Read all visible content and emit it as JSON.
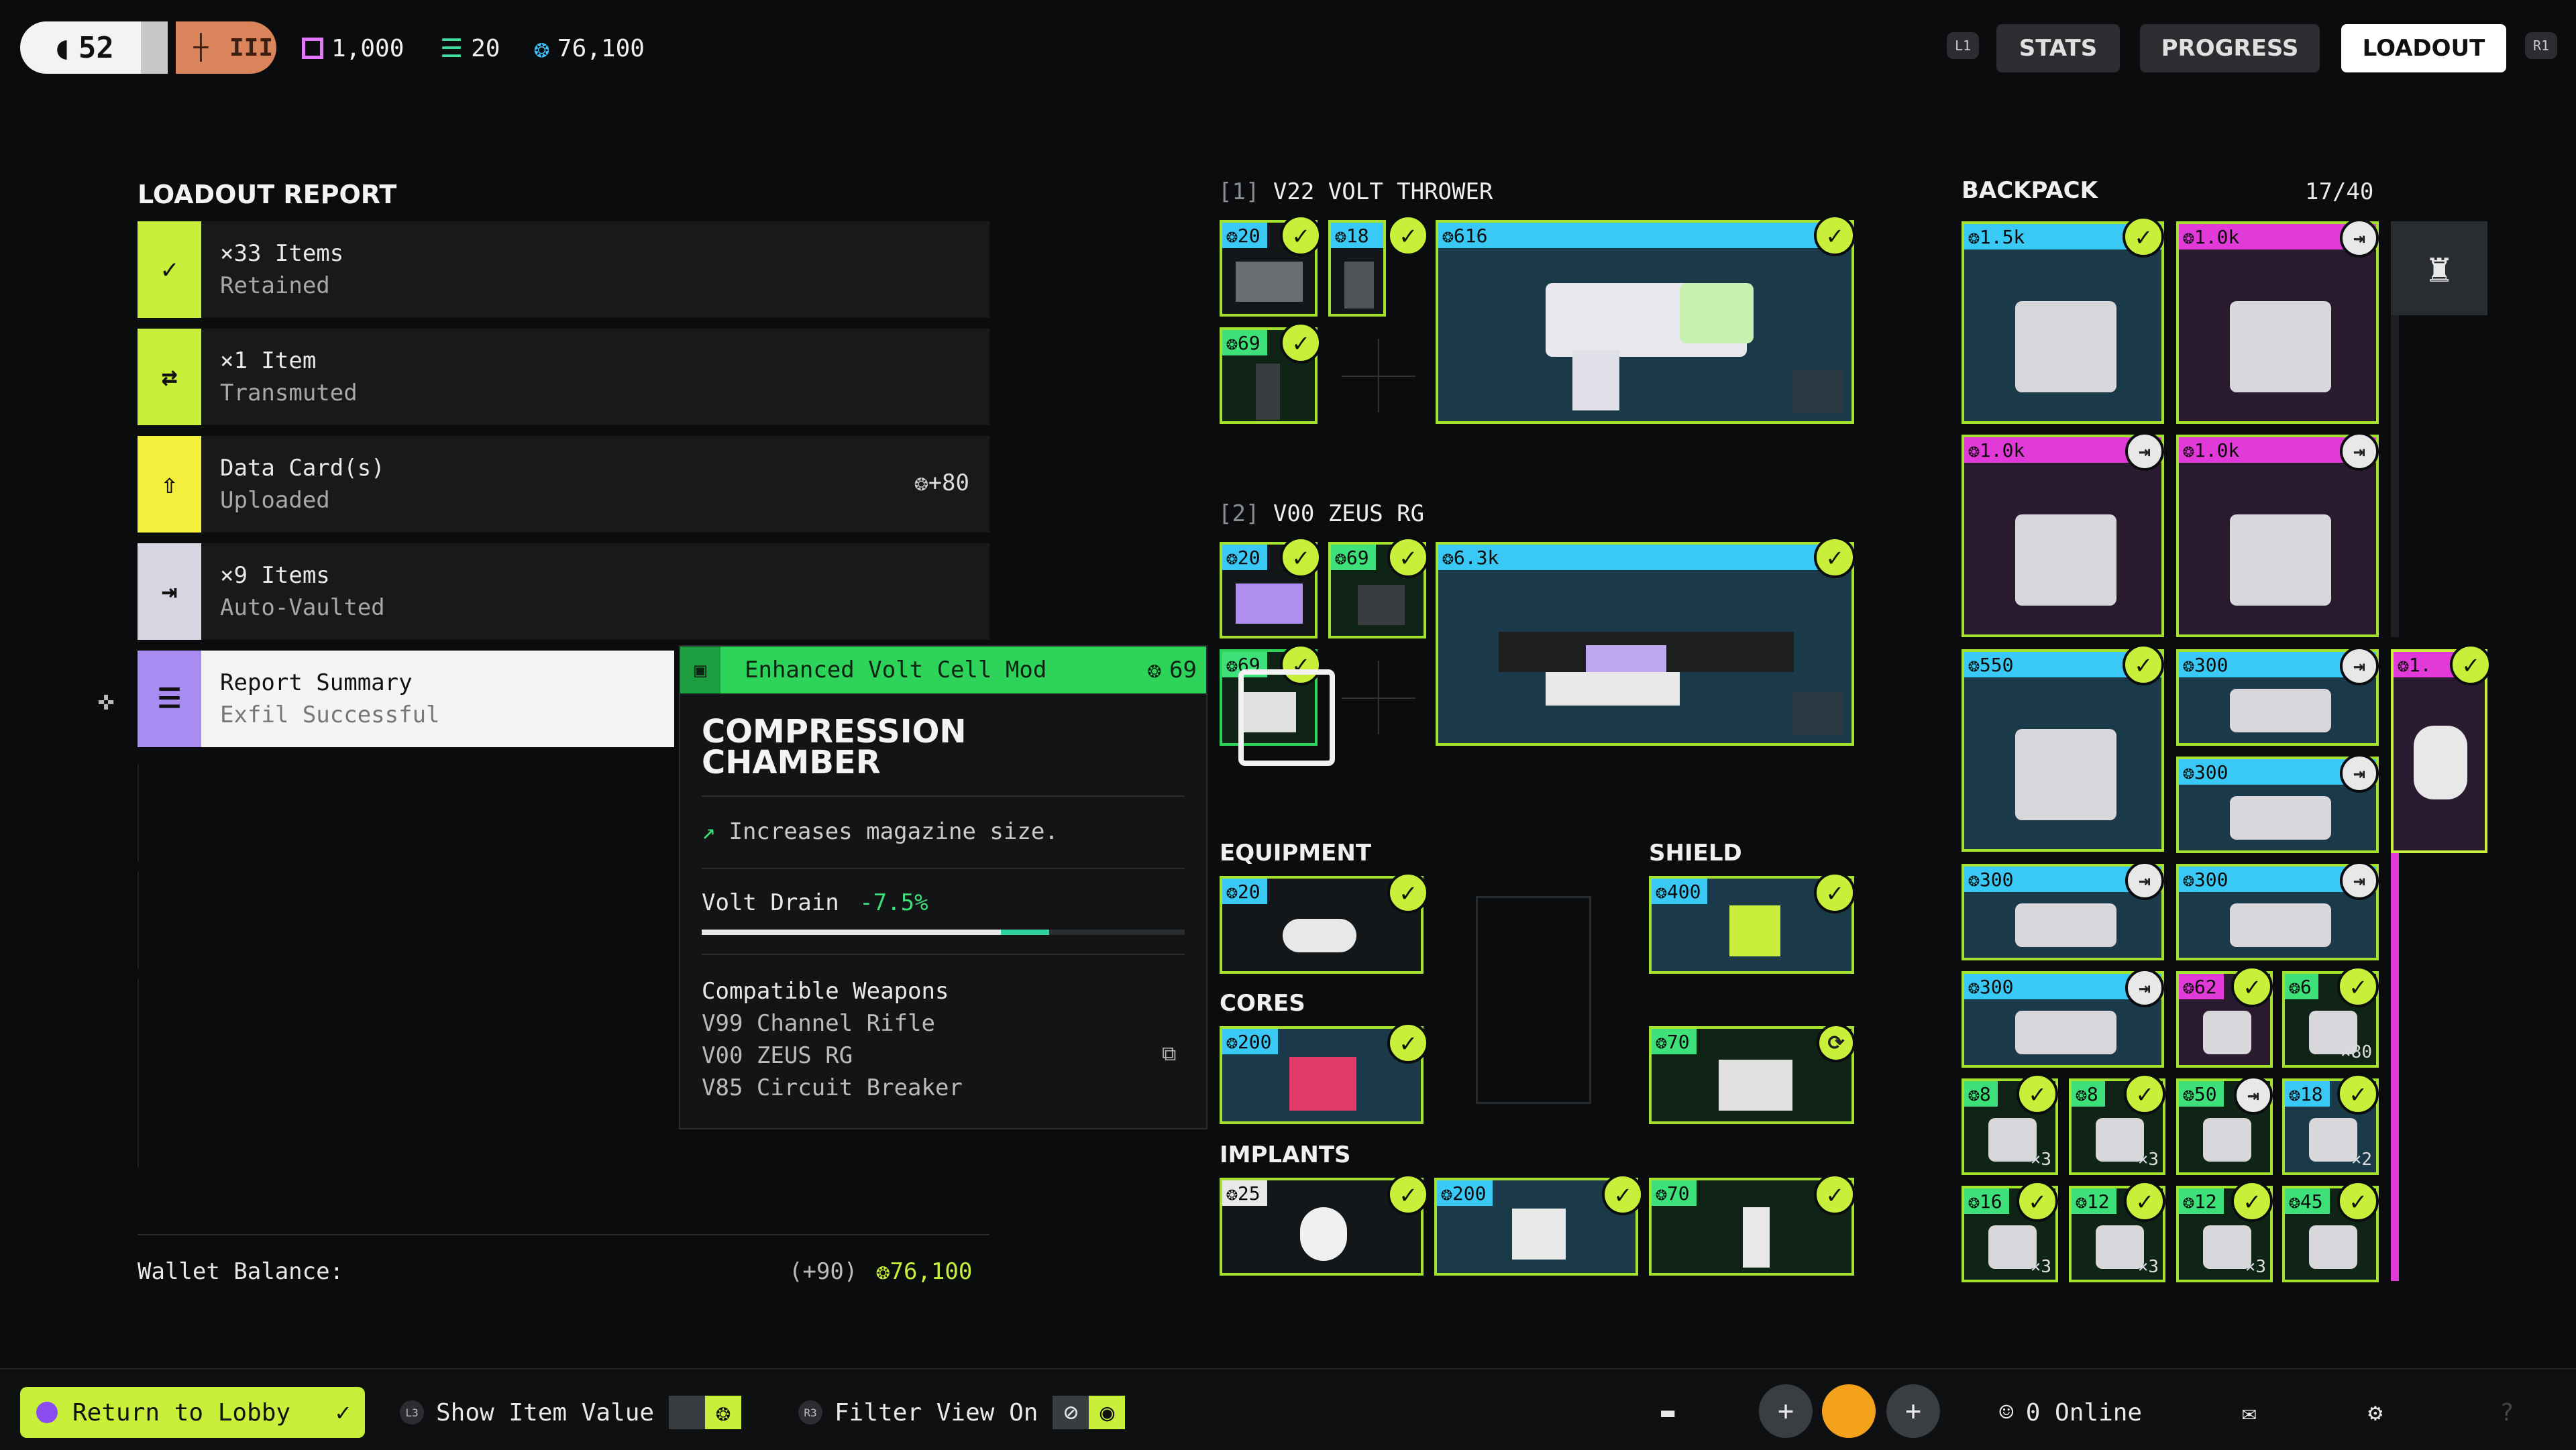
{
  "topbar": {
    "level": "52",
    "rank_numeral": "III",
    "currencies": [
      {
        "icon": "chip-icon",
        "value": "1,000",
        "color": "#e278ff"
      },
      {
        "icon": "stack-icon",
        "value": "20",
        "color": "#3ee0a0"
      },
      {
        "icon": "credits-icon",
        "value": "76,100",
        "color": "#3fc3ff"
      }
    ],
    "left_shoulder": "L1",
    "right_shoulder": "R1",
    "tabs": [
      "STATS",
      "PROGRESS",
      "LOADOUT"
    ],
    "active_tab": "LOADOUT"
  },
  "report": {
    "title": "LOADOUT REPORT",
    "rows": [
      {
        "line1": "×33 Items",
        "line2": "Retained",
        "icon": "check-icon",
        "color": "#c8f03a",
        "extra": ""
      },
      {
        "line1": "×1 Item",
        "line2": "Transmuted",
        "icon": "transmute-icon",
        "color": "#c8f03a",
        "extra": ""
      },
      {
        "line1": "Data Card(s)",
        "line2": "Uploaded",
        "icon": "upload-icon",
        "color": "#f4ef3d",
        "extra": "+80"
      },
      {
        "line1": "×9 Items",
        "line2": "Auto-Vaulted",
        "icon": "vault-icon",
        "color": "#d6d6e2",
        "extra": ""
      },
      {
        "line1": "Report Summary",
        "line2": "Exfil Successful",
        "icon": "list-icon",
        "color": "#a98cf2",
        "extra": ""
      }
    ],
    "wallet_label": "Wallet Balance:",
    "wallet_delta": "(+90)",
    "wallet_value": "76,100"
  },
  "tooltip": {
    "header": "Enhanced Volt Cell Mod",
    "header_value": "69",
    "title_line1": "COMPRESSION",
    "title_line2": "CHAMBER",
    "description": "Increases magazine size.",
    "stat_label": "Volt Drain",
    "stat_value": "-7.5%",
    "stat_fill": 0.72,
    "compatible_label": "Compatible Weapons",
    "weapons": [
      "V99 Channel Rifle",
      "V00 ZEUS RG",
      "V85 Circuit Breaker"
    ]
  },
  "weapons": [
    {
      "slot": "[1]",
      "name": "V22 VOLT THROWER",
      "main_value": "616",
      "mods": [
        "20",
        "18",
        "69"
      ]
    },
    {
      "slot": "[2]",
      "name": "V00 ZEUS RG",
      "main_value": "6.3k",
      "mods": [
        "20",
        "69",
        "69"
      ]
    }
  ],
  "gear": {
    "equipment_label": "EQUIPMENT",
    "equipment_value": "20",
    "shield_label": "SHIELD",
    "shield_value": "400",
    "cores_label": "CORES",
    "cores_values": [
      "200",
      "70"
    ],
    "implants_label": "IMPLANTS",
    "implants_values": [
      "25",
      "200",
      "70"
    ]
  },
  "backpack": {
    "title": "BACKPACK",
    "capacity": "17/40",
    "items": [
      {
        "value": "1.5k",
        "color": "#3ac8f5"
      },
      {
        "value": "1.0k",
        "color": "#e23ad8"
      },
      {
        "value": "1.0k",
        "color": "#e23ad8"
      },
      {
        "value": "1.0k",
        "color": "#e23ad8"
      },
      {
        "value": "550",
        "color": "#3ac8f5"
      },
      {
        "value": "300",
        "color": "#3ac8f5"
      },
      {
        "value": "300",
        "color": "#3ac8f5"
      },
      {
        "value": "300",
        "color": "#3ac8f5"
      },
      {
        "value": "300",
        "color": "#3ac8f5"
      },
      {
        "value": "300",
        "color": "#3ac8f5"
      },
      {
        "value": "62",
        "color": "#e23ad8"
      },
      {
        "value": "6",
        "color": "#3ee07a",
        "qty": "×80"
      },
      {
        "value": "8",
        "color": "#3ee07a",
        "qty": "×3"
      },
      {
        "value": "8",
        "color": "#3ee07a",
        "qty": "×3"
      },
      {
        "value": "50",
        "color": "#3ee07a"
      },
      {
        "value": "18",
        "color": "#3ac8f5",
        "qty": "×2"
      },
      {
        "value": "16",
        "color": "#3ee07a",
        "qty": "×3"
      },
      {
        "value": "12",
        "color": "#3ee07a",
        "qty": "×3"
      },
      {
        "value": "12",
        "color": "#3ee07a",
        "qty": "×3"
      },
      {
        "value": "45",
        "color": "#3ee07a"
      }
    ],
    "side_value": "1."
  },
  "bottombar": {
    "return_label": "Return to Lobby",
    "show_value_label": "Show Item Value",
    "show_value_key": "L3",
    "filter_label": "Filter View On",
    "filter_key": "R3",
    "online_label": "0 Online"
  }
}
